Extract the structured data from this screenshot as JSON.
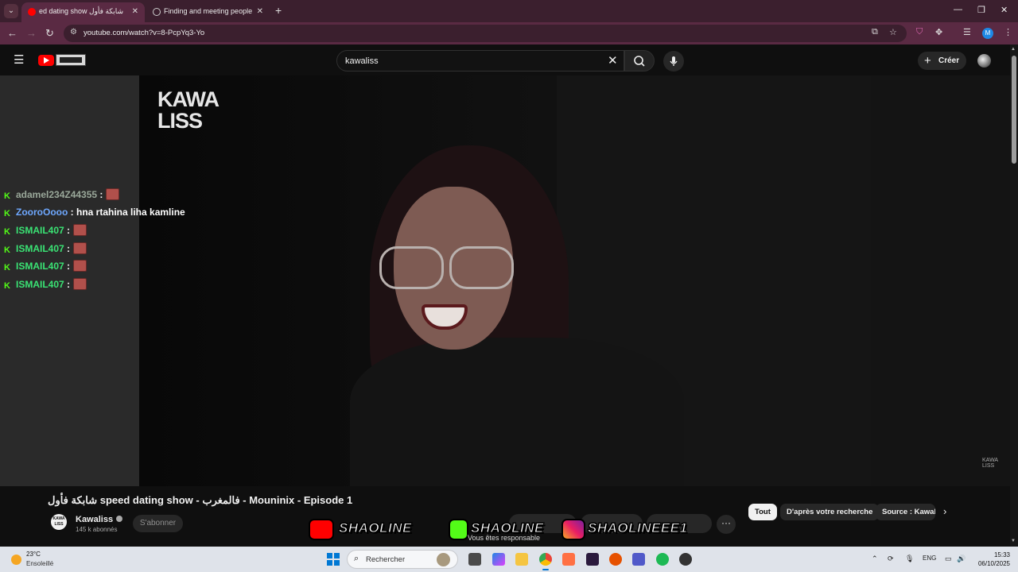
{
  "browser": {
    "tabs": [
      {
        "title": "ed dating show شابكة فأول",
        "active": true
      },
      {
        "title": "Finding and meeting people",
        "active": false
      }
    ],
    "url": "youtube.com/watch?v=8-PcpYq3-Yo",
    "profile_initial": "M"
  },
  "youtube": {
    "search_value": "kawaliss",
    "create_label": "Créer"
  },
  "video": {
    "logo_line1": "KAWA",
    "logo_line2": "LISS",
    "watermark": "KAWA LISS",
    "chat": [
      {
        "user": "adamel234Z44355",
        "sep": " :",
        "text": "",
        "emote": true,
        "color": "gray"
      },
      {
        "user": "ZooroOooo",
        "sep": " : ",
        "text": "hna rtahina liha kamline",
        "emote": false,
        "color": "blue"
      },
      {
        "user": "ISMAIL407",
        "sep": " :",
        "text": "",
        "emote": true,
        "color": "green"
      },
      {
        "user": "ISMAIL407",
        "sep": " :",
        "text": "",
        "emote": true,
        "color": "green"
      },
      {
        "user": "ISMAIL407",
        "sep": " :",
        "text": "",
        "emote": true,
        "color": "green"
      },
      {
        "user": "ISMAIL407",
        "sep": " :",
        "text": "",
        "emote": true,
        "color": "green"
      }
    ]
  },
  "meta": {
    "title": "شابكة فأول speed dating show - فالمغرب - Mouninix - Episode 1",
    "channel": "Kawaliss",
    "channel_avatar_text": "KAWA LISS",
    "subscribers": "145 k abonnés",
    "subscribe_label": "S'abonner",
    "more_label": "···",
    "chips": [
      "Tout",
      "D'après votre recherche",
      "Source : Kawaliss"
    ],
    "notice": "Vous êtes responsable"
  },
  "overlay": {
    "youtube": "SHAOLINE",
    "kick": "SHAOLINE",
    "instagram": "SHAOLINEEE1"
  },
  "taskbar": {
    "temperature": "23°C",
    "weather": "Ensoleillé",
    "search_label": "Rechercher",
    "lang": "ENG",
    "time": "15:33",
    "date": "06/10/2025"
  },
  "colors": {
    "accent_red": "#ff0000",
    "kick_green": "#53fc18",
    "browser_frame": "#3b1f2e"
  }
}
